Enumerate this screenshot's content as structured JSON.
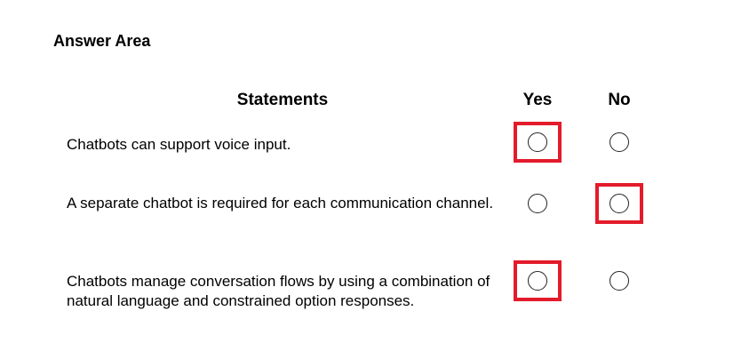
{
  "answer_area": {
    "title": "Answer Area",
    "headers": {
      "statements": "Statements",
      "yes": "Yes",
      "no": "No"
    },
    "statements": [
      {
        "text": "Chatbots can support voice input.",
        "selected": "yes"
      },
      {
        "text": "A separate chatbot is required for each communication channel.",
        "selected": "no"
      },
      {
        "text": "Chatbots manage conversation flows by using a combination of natural language and constrained option responses.",
        "selected": "yes"
      }
    ],
    "highlight_color": "#e31b2b"
  }
}
